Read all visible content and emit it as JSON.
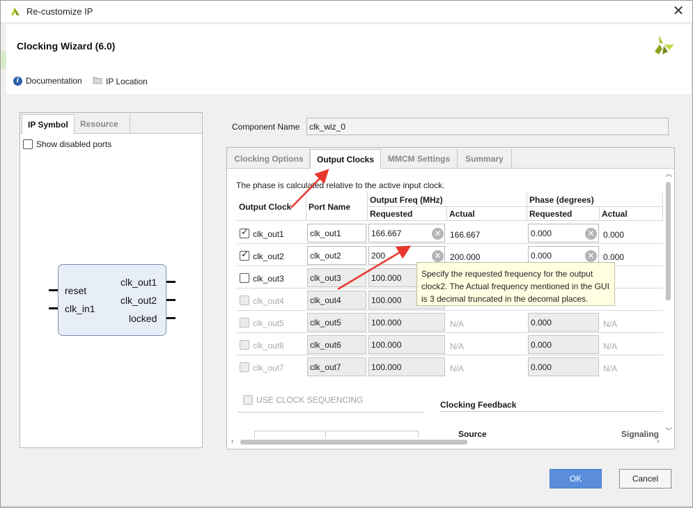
{
  "window": {
    "title": "Re-customize IP",
    "close_glyph": "✕"
  },
  "header": {
    "wizard_title": "Clocking Wizard (6.0)",
    "documentation": "Documentation",
    "ip_location": "IP Location"
  },
  "left_panel": {
    "tabs": [
      "IP Symbol",
      "Resource"
    ],
    "show_disabled_ports": "Show disabled ports",
    "symbol": {
      "inputs": [
        "reset",
        "clk_in1"
      ],
      "outputs": [
        "clk_out1",
        "clk_out2",
        "locked"
      ]
    }
  },
  "component": {
    "label": "Component Name",
    "value": "clk_wiz_0"
  },
  "tabs": [
    "Clocking Options",
    "Output Clocks",
    "MMCM Settings",
    "Summary"
  ],
  "active_tab": "Output Clocks",
  "phase_note": "The phase is calculated relative to the active input clock.",
  "table": {
    "headers": {
      "output_clock": "Output Clock",
      "port_name": "Port Name",
      "output_freq": "Output Freq (MHz)",
      "phase": "Phase (degrees)",
      "requested": "Requested",
      "actual": "Actual"
    },
    "rows": [
      {
        "clock": "clk_out1",
        "checked": true,
        "enabled": true,
        "port": "clk_out1",
        "freq_req": "166.667",
        "freq_act": "166.667",
        "phase_req": "0.000",
        "phase_act": "0.000"
      },
      {
        "clock": "clk_out2",
        "checked": true,
        "enabled": true,
        "port": "clk_out2",
        "freq_req": "200",
        "freq_act": "200.000",
        "phase_req": "0.000",
        "phase_act": "0.000"
      },
      {
        "clock": "clk_out3",
        "checked": false,
        "enabled": true,
        "port": "clk_out3",
        "freq_req": "100.000",
        "freq_act": "",
        "phase_req": "",
        "phase_act": ""
      },
      {
        "clock": "clk_out4",
        "checked": false,
        "enabled": false,
        "port": "clk_out4",
        "freq_req": "100.000",
        "freq_act": "",
        "phase_req": "",
        "phase_act": ""
      },
      {
        "clock": "clk_out5",
        "checked": false,
        "enabled": false,
        "port": "clk_out5",
        "freq_req": "100.000",
        "freq_act": "N/A",
        "phase_req": "0.000",
        "phase_act": "N/A"
      },
      {
        "clock": "clk_out6",
        "checked": false,
        "enabled": false,
        "port": "clk_out6",
        "freq_req": "100.000",
        "freq_act": "N/A",
        "phase_req": "0.000",
        "phase_act": "N/A"
      },
      {
        "clock": "clk_out7",
        "checked": false,
        "enabled": false,
        "port": "clk_out7",
        "freq_req": "100.000",
        "freq_act": "N/A",
        "phase_req": "0.000",
        "phase_act": "N/A"
      }
    ]
  },
  "tooltip": "Specify the requested frequency for the output clock2. The Actual frequency mentioned in the GUI is 3 decimal truncated in the decomal places.",
  "use_clock_sequencing": "USE CLOCK SEQUENCING",
  "clocking_feedback": {
    "title": "Clocking Feedback",
    "source": "Source",
    "signaling": "Signaling"
  },
  "buttons": {
    "ok": "OK",
    "cancel": "Cancel"
  },
  "colors": {
    "ok_button": "#5a8edc",
    "annotation_arrow": "#e8352a",
    "tooltip_bg": "#ffffe1"
  }
}
